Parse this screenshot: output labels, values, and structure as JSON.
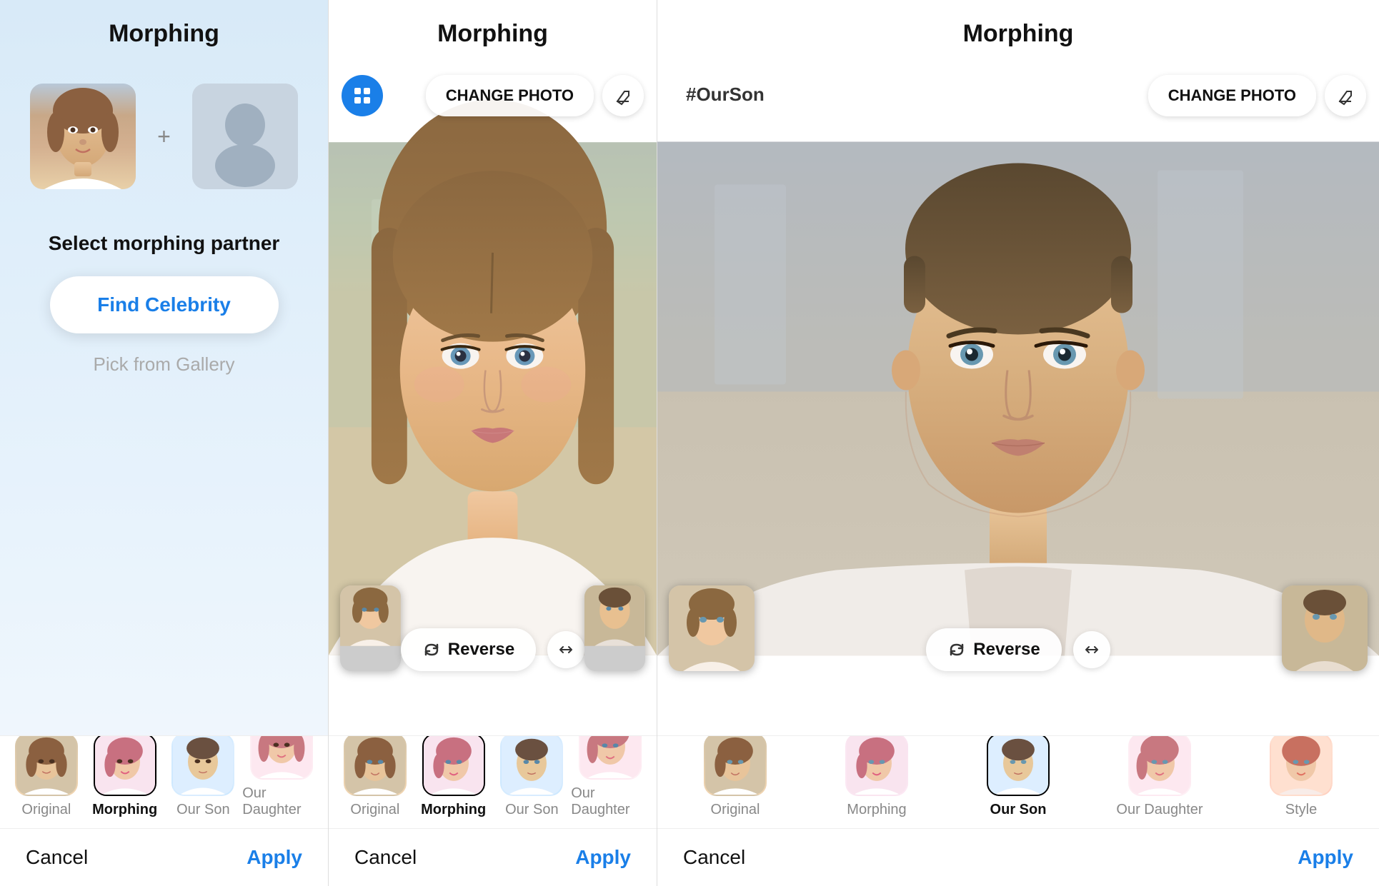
{
  "panels": [
    {
      "id": "panel1",
      "title": "Morphing",
      "type": "select",
      "select_partner_label": "Select morphing partner",
      "find_celebrity_label": "Find Celebrity",
      "pick_gallery_label": "Pick from Gallery",
      "tabs": [
        {
          "label": "Original",
          "active": false,
          "bg": "face-thumb-1"
        },
        {
          "label": "Morphing",
          "active": true,
          "bg": "face-thumb-2"
        },
        {
          "label": "Our Son",
          "active": false,
          "bg": "face-thumb-3"
        },
        {
          "label": "Our Daughter",
          "active": false,
          "bg": "face-thumb-4"
        }
      ],
      "cancel_label": "Cancel",
      "apply_label": "Apply"
    },
    {
      "id": "panel2",
      "title": "Morphing",
      "type": "result",
      "change_photo_label": "CHANGE PHOTO",
      "reverse_label": "Reverse",
      "tabs": [
        {
          "label": "Original",
          "active": false,
          "bg": "face-thumb-1"
        },
        {
          "label": "Morphing",
          "active": true,
          "bg": "face-thumb-2"
        },
        {
          "label": "Our Son",
          "active": false,
          "bg": "face-thumb-3"
        },
        {
          "label": "Our Daughter",
          "active": false,
          "bg": "face-thumb-4"
        }
      ],
      "cancel_label": "Cancel",
      "apply_label": "Apply"
    },
    {
      "id": "panel3",
      "title": "Morphing",
      "type": "result-son",
      "change_photo_label": "CHANGE PHOTO",
      "hashtag": "#OurSon",
      "reverse_label": "Reverse",
      "tabs": [
        {
          "label": "Original",
          "active": false,
          "bg": "face-thumb-1"
        },
        {
          "label": "Morphing",
          "active": false,
          "bg": "face-thumb-2"
        },
        {
          "label": "Our Son",
          "active": true,
          "bg": "face-thumb-3"
        },
        {
          "label": "Our Daughter",
          "active": false,
          "bg": "face-thumb-4"
        },
        {
          "label": "Style",
          "active": false,
          "bg": "face-thumb-1"
        }
      ],
      "cancel_label": "Cancel",
      "apply_label": "Apply"
    }
  ],
  "icons": {
    "grid": "⊞",
    "eraser": "◇",
    "reverse": "↻",
    "expand": "↔"
  }
}
